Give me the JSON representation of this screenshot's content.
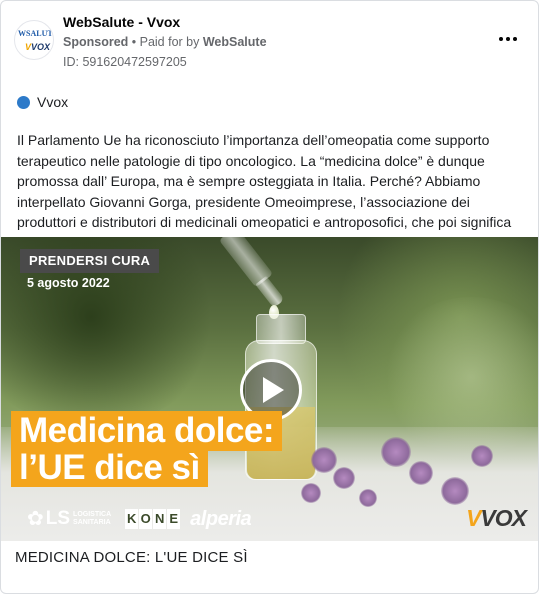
{
  "header": {
    "page_name": "WebSalute - Vvox",
    "sponsored": "Sponsored",
    "paid_for_prefix": " • Paid for by ",
    "paid_for_name": "WebSalute",
    "ad_id": "ID: 591620472597205",
    "avatar_text_top": "WSALUTE",
    "avatar_text_bottom_a": "V",
    "avatar_text_bottom_b": "VOX"
  },
  "platform": {
    "label": "Vvox",
    "color": "#2d7ac9"
  },
  "body_text": "Il Parlamento Ue ha riconosciuto l’importanza dell’omeopatia come supporto terapeutico nelle patologie di tipo oncologico. La “medicina dolce” è dunque promossa dall’ Europa, ma è sempre osteggiata in Italia. Perché? Abbiamo interpellato Giovanni Gorga, presidente Omeoimprese, l’associazione dei produttori e distributori di medicinali omeopatici e antroposofici, che poi significa medicina…",
  "media": {
    "tag": "PRENDERSI CURA",
    "date": "5 agosto 2022",
    "headline_line1": "Medicina dolce:",
    "headline_line2": "l’UE dice sì",
    "accent_color": "#f4a51c",
    "logos": {
      "ls": "LS",
      "ls_sub_line1": "LOGISTICA",
      "ls_sub_line2": "SANITARIA",
      "kone": [
        "K",
        "O",
        "N",
        "E"
      ],
      "alperia": "alperia",
      "vvox_a": "V",
      "vvox_b": "VOX"
    }
  },
  "caption": "MEDICINA DOLCE: L'UE DICE SÌ"
}
